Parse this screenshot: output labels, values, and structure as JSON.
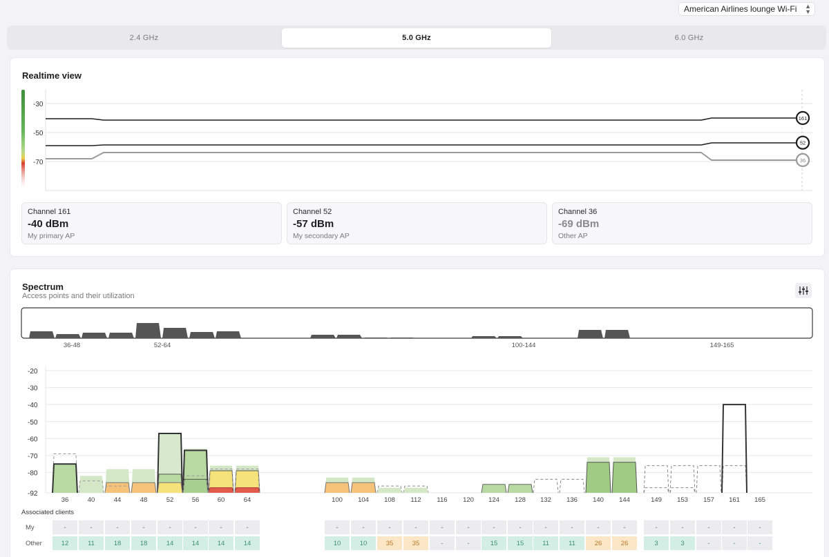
{
  "network_select": {
    "value": "American Airlines lounge Wi-Fi"
  },
  "tabs": [
    {
      "label": "2.4 GHz",
      "active": false
    },
    {
      "label": "5.0 GHz",
      "active": true
    },
    {
      "label": "6.0 GHz",
      "active": false
    }
  ],
  "realtime": {
    "title": "Realtime view",
    "y_ticks": [
      "-30",
      "-50",
      "-70"
    ],
    "lines": [
      {
        "channel": "161",
        "color": "#1d1d1d",
        "current_dbm": -40
      },
      {
        "channel": "52",
        "color": "#1d1d1d",
        "current_dbm": -57
      },
      {
        "channel": "36",
        "color": "#9a9a9a",
        "current_dbm": -69
      }
    ],
    "channels": [
      {
        "name": "Channel 161",
        "value": "-40 dBm",
        "role": "My primary AP"
      },
      {
        "name": "Channel 52",
        "value": "-57 dBm",
        "role": "My secondary AP"
      },
      {
        "name": "Channel 36",
        "value": "-69 dBm",
        "role": "Other AP"
      }
    ]
  },
  "spectrum": {
    "title": "Spectrum",
    "subtitle": "Access points and their utilization",
    "filter_icon": "sliders-icon",
    "overview_labels": [
      "36-48",
      "52-64",
      "100-144",
      "149-165"
    ],
    "y_ticks": [
      "-20",
      "-30",
      "-40",
      "-50",
      "-60",
      "-70",
      "-80",
      "-92"
    ],
    "channels": [
      "36",
      "40",
      "44",
      "48",
      "52",
      "56",
      "60",
      "64",
      "100",
      "104",
      "108",
      "112",
      "116",
      "120",
      "124",
      "128",
      "132",
      "136",
      "140",
      "144",
      "149",
      "153",
      "157",
      "161",
      "165"
    ],
    "associated_clients": {
      "title": "Associated clients",
      "row_labels": [
        "My",
        "Other"
      ],
      "groups": [
        {
          "my": [
            "-",
            "-",
            "-",
            "-",
            "-",
            "-",
            "-",
            "-"
          ],
          "other": [
            "12",
            "11",
            "18",
            "18",
            "14",
            "14",
            "14",
            "14"
          ]
        },
        {
          "my": [
            "-",
            "-",
            "-",
            "-",
            "-",
            "-",
            "-",
            "-",
            "-",
            "-",
            "-",
            "-"
          ],
          "other": [
            "10",
            "10",
            "35",
            "35",
            "-",
            "-",
            "15",
            "15",
            "11",
            "11",
            "26",
            "26"
          ]
        },
        {
          "my": [
            "-",
            "-",
            "-",
            "-",
            "-"
          ],
          "other": [
            "3",
            "3",
            "-",
            "-",
            "-"
          ]
        }
      ]
    }
  }
}
